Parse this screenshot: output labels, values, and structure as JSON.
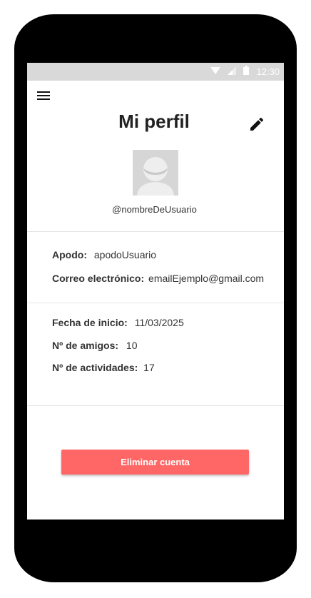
{
  "status_bar": {
    "time": "12:30",
    "icons": [
      "wifi-icon",
      "signal-icon",
      "battery-icon"
    ]
  },
  "header": {
    "title": "Mi perfil",
    "menu_icon": "menu-icon",
    "edit_icon": "pencil-icon"
  },
  "profile": {
    "avatar_icon": "user-placeholder-icon",
    "username": "@nombreDeUsuario"
  },
  "account": {
    "nickname_label": "Apodo:",
    "nickname_value": "apodoUsuario",
    "email_label": "Correo electrónico:",
    "email_value": "emailEjemplo@gmail.com"
  },
  "stats": {
    "start_date_label": "Fecha de inicio:",
    "start_date_value": "11/03/2025",
    "friends_label": "Nº de amigos:",
    "friends_value": "10",
    "activities_label": "Nº de actividades:",
    "activities_value": "17"
  },
  "actions": {
    "delete_label": "Eliminar cuenta"
  },
  "colors": {
    "status_bar": "#d9d9d9",
    "danger": "#ff6666",
    "device_frame": "#000000"
  }
}
